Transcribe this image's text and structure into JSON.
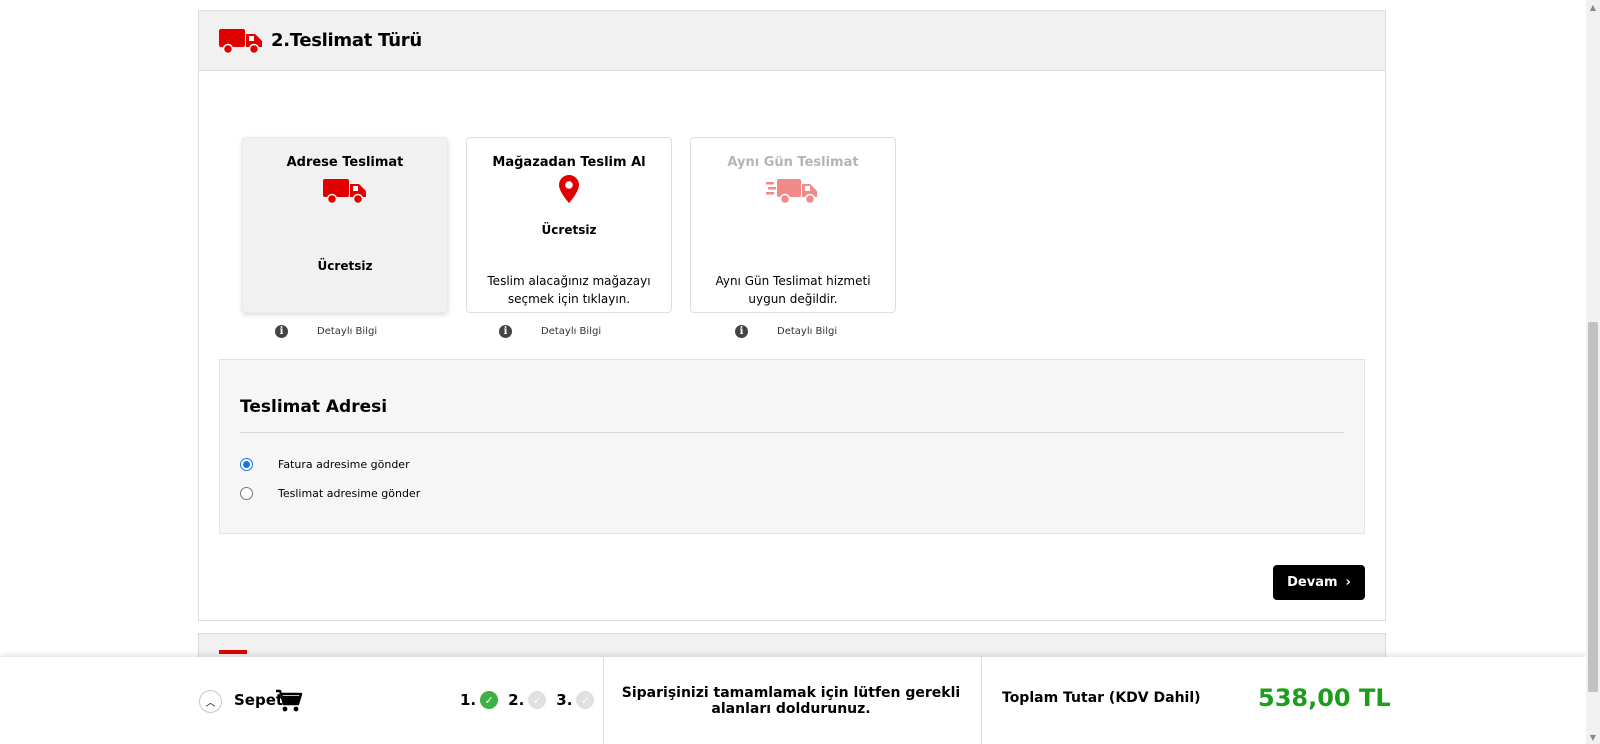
{
  "section": {
    "title": "2.Teslimat Türü",
    "icon": "truck-icon",
    "accent_color": "#e10000"
  },
  "options": [
    {
      "title": "Adrese Teslimat",
      "icon": "truck-icon",
      "price": "Ücretsiz",
      "description": "",
      "info_label": "Detaylı Bilgi",
      "selected": true
    },
    {
      "title": "Mağazadan Teslim Al",
      "icon": "location-pin-icon",
      "price": "Ücretsiz",
      "description": "Teslim alacağınız mağazayı seçmek için tıklayın.",
      "info_label": "Detaylı Bilgi",
      "selected": false
    },
    {
      "title": "Aynı Gün Teslimat",
      "icon": "fast-truck-icon",
      "price": "",
      "description": "Aynı Gün Teslimat hizmeti uygun değildir.",
      "info_label": "Detaylı Bilgi",
      "selected": false
    }
  ],
  "address": {
    "title": "Teslimat Adresi",
    "radios": [
      {
        "label": "Fatura adresime gönder",
        "checked": true
      },
      {
        "label": "Teslimat adresime gönder",
        "checked": false
      }
    ]
  },
  "continue_button": {
    "label": "Devam",
    "icon": "chevron-right-icon"
  },
  "bottom_bar": {
    "cart_label": "Sepet",
    "steps": [
      {
        "label": "1.",
        "done": true
      },
      {
        "label": "2.",
        "done": false
      },
      {
        "label": "3.",
        "done": false
      }
    ],
    "message": "Siparişinizi tamamlamak için lütfen gerekli alanları doldurunuz.",
    "total_label": "Toplam Tutar (KDV Dahil)",
    "total_value": "538,00 TL",
    "total_color": "#1b9e1b"
  }
}
